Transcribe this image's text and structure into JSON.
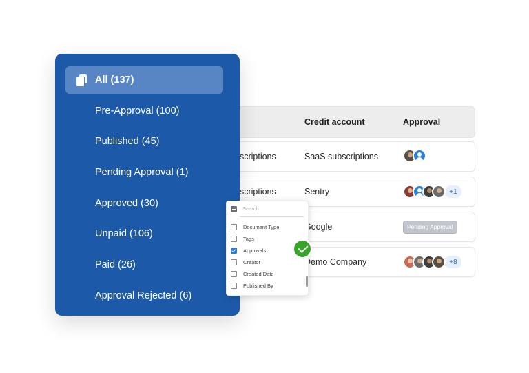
{
  "table": {
    "headers": {
      "credit_account": "Credit account",
      "approval": "Approval"
    },
    "rows": [
      {
        "col1": "bscriptions",
        "credit_account": "SaaS subscriptions",
        "approval": {
          "avatars": [
            "user-photo",
            "user-default"
          ],
          "more": ""
        }
      },
      {
        "col1": "bscriptions",
        "credit_account": "Sentry",
        "approval": {
          "avatars": [
            "user-photo",
            "user-default",
            "user-photo",
            "user-photo"
          ],
          "more": "+1"
        }
      },
      {
        "col1": "",
        "credit_account": "Google",
        "approval": {
          "status": "Pending Approval"
        }
      },
      {
        "col1": "",
        "credit_account": "Demo Company",
        "approval": {
          "avatars": [
            "user-photo",
            "user-photo",
            "user-photo",
            "user-photo"
          ],
          "more": "+8"
        }
      }
    ]
  },
  "sidebar": {
    "items": [
      {
        "label": "All (137)",
        "active": true,
        "icon": "copy-icon"
      },
      {
        "label": "Pre-Approval (100)"
      },
      {
        "label": "Published (45)"
      },
      {
        "label": "Pending Approval (1)"
      },
      {
        "label": "Approved (30)"
      },
      {
        "label": "Unpaid (106)"
      },
      {
        "label": "Paid (26)"
      },
      {
        "label": "Approval Rejected (6)"
      }
    ]
  },
  "dropdown": {
    "search_placeholder": "Search",
    "options": [
      {
        "label": "Document Type",
        "checked": false
      },
      {
        "label": "Tags",
        "checked": false
      },
      {
        "label": "Approvals",
        "checked": true
      },
      {
        "label": "Creator",
        "checked": false
      },
      {
        "label": "Created Date",
        "checked": false
      },
      {
        "label": "Published By",
        "checked": false
      }
    ]
  },
  "colors": {
    "sidebar_bg": "#1c5aa9",
    "sidebar_active": "#5885c3",
    "check_badge": "#3aa32c",
    "checkbox_checked": "#2e7bd6"
  }
}
